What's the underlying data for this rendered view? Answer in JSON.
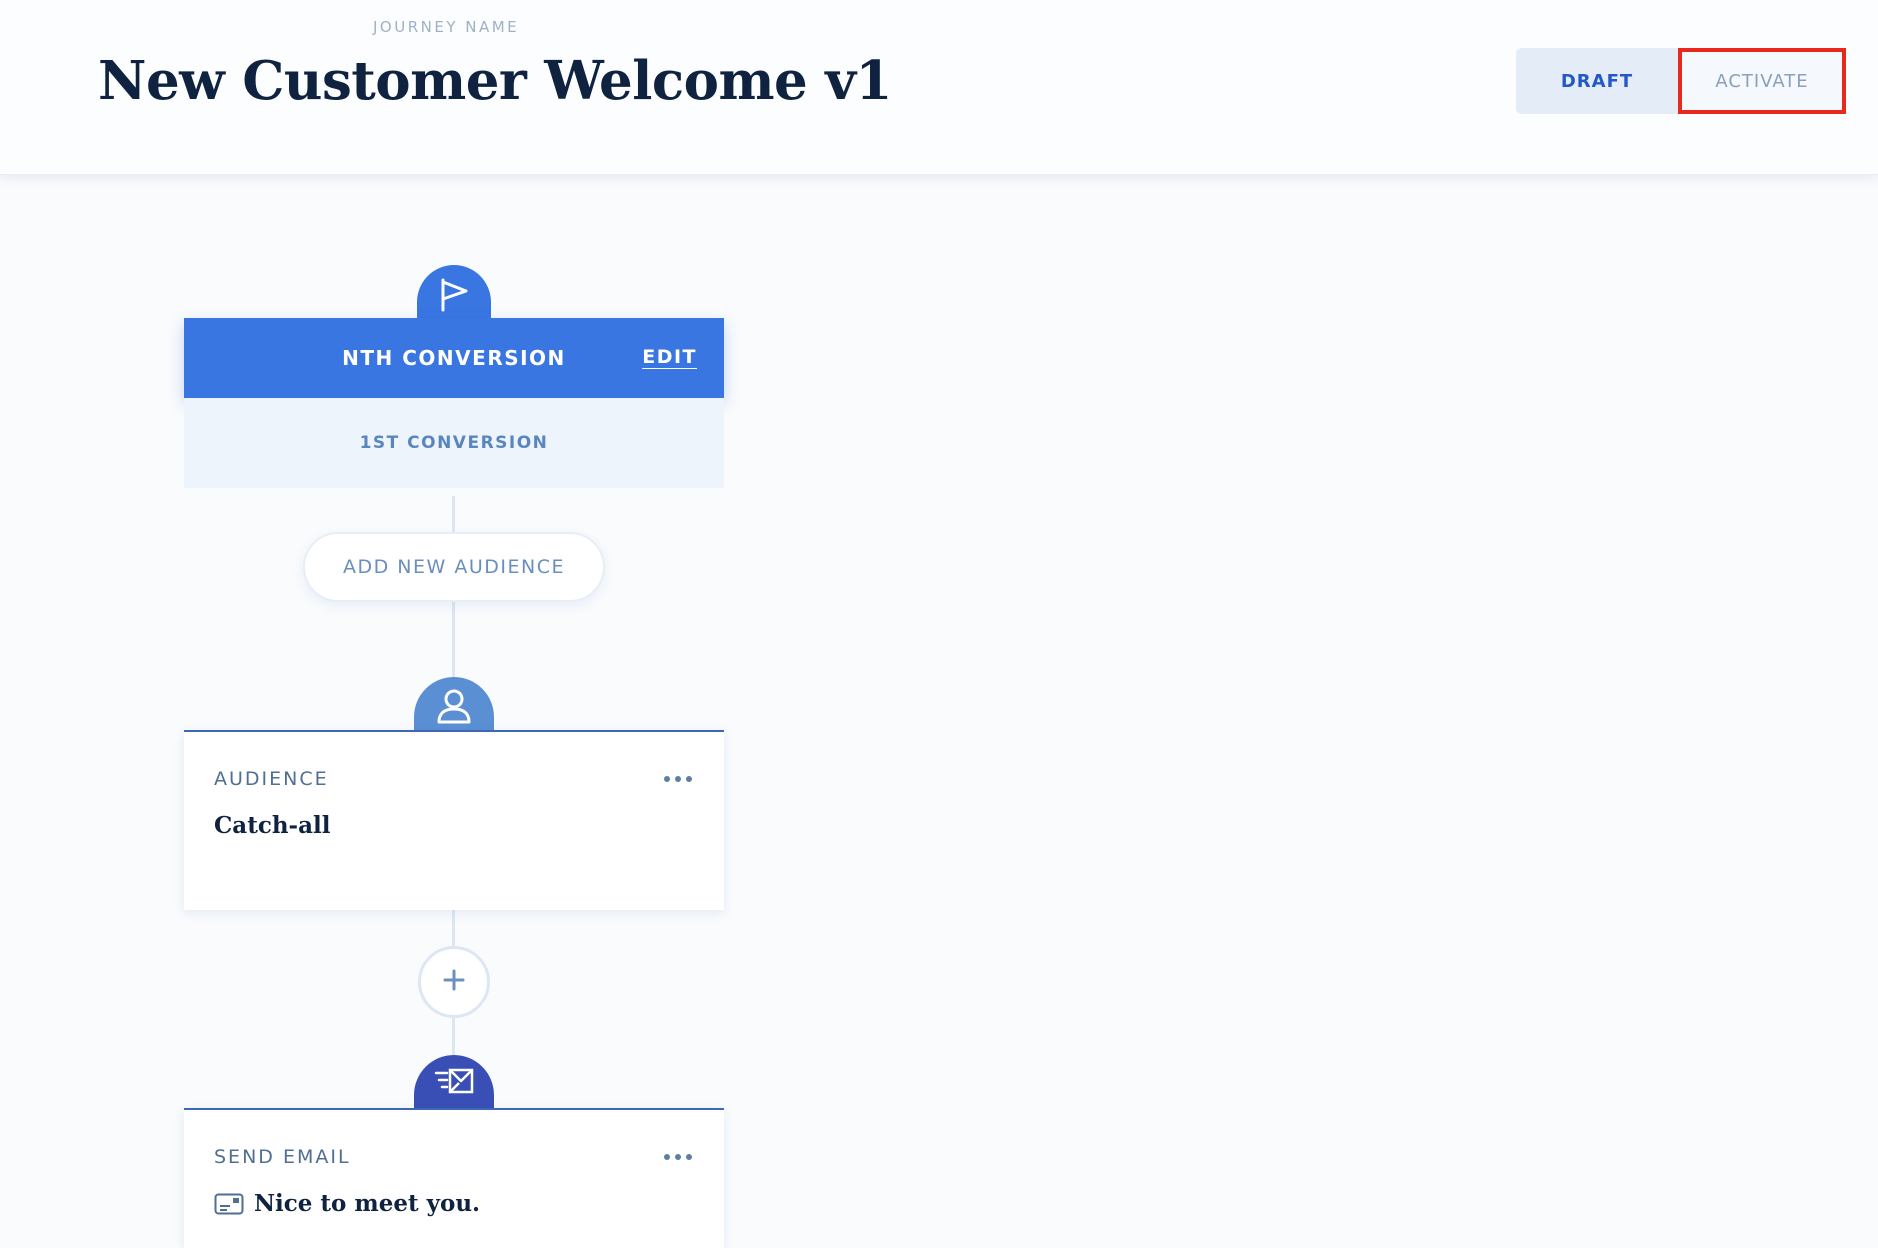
{
  "header": {
    "journey_label": "JOURNEY NAME",
    "title": "New Customer Welcome v1",
    "status": {
      "draft_label": "DRAFT",
      "activate_label": "ACTIVATE"
    }
  },
  "trigger": {
    "icon": "flag-icon",
    "title": "NTH CONVERSION",
    "edit_label": "EDIT",
    "subtitle": "1ST CONVERSION"
  },
  "add_audience_label": "ADD NEW AUDIENCE",
  "steps": [
    {
      "icon": "user-icon",
      "label": "AUDIENCE",
      "value": "Catch-all"
    },
    {
      "icon": "send-email-icon",
      "label": "SEND EMAIL",
      "value_icon": "email-template-icon",
      "value": "Nice to meet you."
    }
  ],
  "colors": {
    "accent": "#3a76e2",
    "audience_badge": "#5b8fd4",
    "email_badge": "#3a4fb6",
    "highlight": "#e8281c"
  }
}
